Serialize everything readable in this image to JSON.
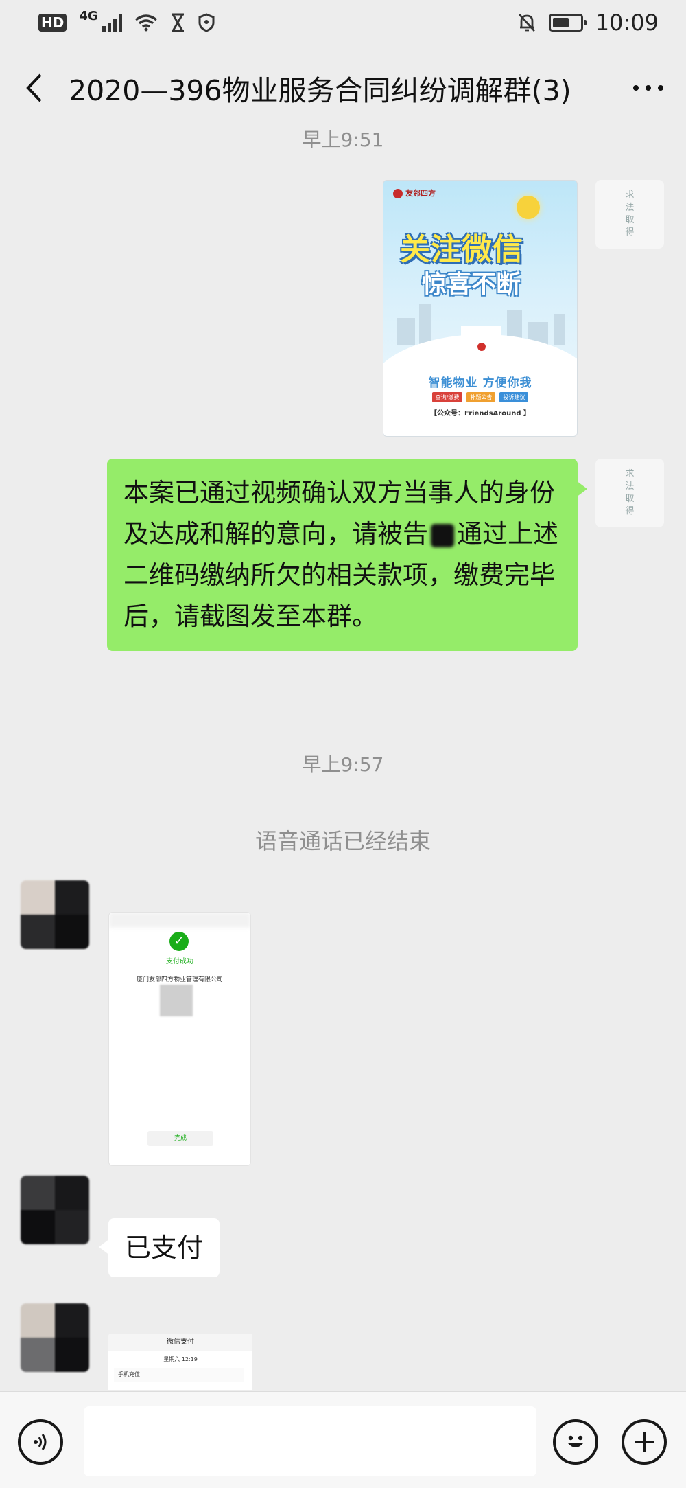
{
  "status_bar": {
    "hd": "HD",
    "network": "4G",
    "time": "10:09"
  },
  "header": {
    "back_icon": "chevron-left-icon",
    "title": "2020—396物业服务合同纠纷调解群(3)",
    "more_icon": "more-dots-icon"
  },
  "messages": {
    "time_1": "早上9:51",
    "poster": {
      "brand": "友邻四方",
      "headline": "关注微信",
      "subline": "惊喜不断",
      "slogan": "智能物业  方便你我",
      "tags": [
        "查询/缴费",
        "补题公告",
        "投诉建议"
      ],
      "tag_colors": [
        "#d9413a",
        "#f0a030",
        "#3a8fd9"
      ],
      "account": "【公众号：FriendsAround 】"
    },
    "notice": {
      "part1": "本案已通过视频确认双方当事人的身份及达成和解的意向，请被告",
      "part2": "通过上述二维码缴纳所欠的相关款项，缴费完毕后，请截图发至本群。"
    },
    "time_2": "早上9:57",
    "system": "语音通话已经结束",
    "payment_screenshot": {
      "status": "支付成功",
      "merchant": "厦门友邻四方物业管理有限公司",
      "done": "完成"
    },
    "paid_text": "已支付",
    "wxpay_screenshot": {
      "title": "微信支付",
      "date": "星期六 12:19",
      "row": "手机充值"
    }
  },
  "input_bar": {
    "voice_icon": "voice-icon",
    "placeholder": "",
    "emoji_icon": "emoji-icon",
    "add_icon": "plus-icon"
  }
}
